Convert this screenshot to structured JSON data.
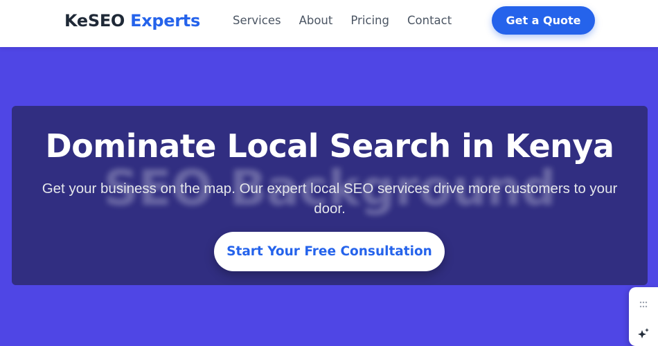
{
  "header": {
    "logo_part1": "KeSEO",
    "logo_part2": "Experts",
    "nav": [
      {
        "label": "Services"
      },
      {
        "label": "About"
      },
      {
        "label": "Pricing"
      },
      {
        "label": "Contact"
      }
    ],
    "cta_label": "Get a Quote"
  },
  "hero": {
    "title": "Dominate Local Search in Kenya",
    "subtitle": "Get your business on the map. Our expert local SEO services drive more customers to your door.",
    "watermark": "SEO Background",
    "cta_label": "Start Your Free Consultation"
  },
  "widget": {
    "icons": [
      "grip-dots-icon",
      "sparkle-icon"
    ]
  },
  "colors": {
    "brand_blue": "#2563eb",
    "hero_bg": "#4f46e5",
    "hero_card": "#312e81",
    "text_dark": "#1f2937"
  }
}
